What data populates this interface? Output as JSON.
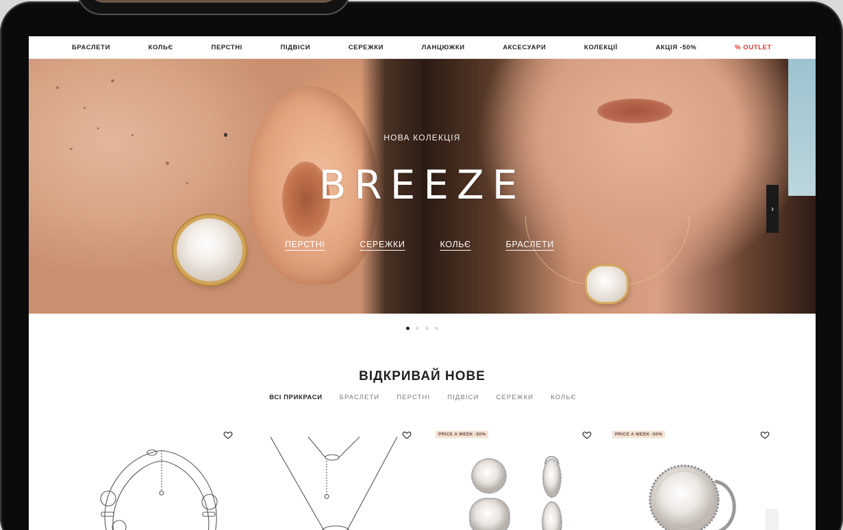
{
  "nav": {
    "items": [
      {
        "label": "БРАСЛЕТИ"
      },
      {
        "label": "КОЛЬЄ"
      },
      {
        "label": "ПЕРСТНІ"
      },
      {
        "label": "ПІДВІСИ"
      },
      {
        "label": "СЕРЕЖКИ"
      },
      {
        "label": "ЛАНЦЮЖКИ"
      },
      {
        "label": "АКСЕСУАРИ"
      },
      {
        "label": "КОЛЕКЦІЇ"
      },
      {
        "label": "АКЦІЯ -50%"
      },
      {
        "label": "% OUTLET"
      }
    ],
    "highlight_color": "#e0342b"
  },
  "hero": {
    "subtitle": "НОВА КОЛЕКЦІЯ",
    "title": "BREEZE",
    "links": [
      "ПЕРСТНІ",
      "СЕРЕЖКИ",
      "КОЛЬЄ",
      "БРАСЛЕТИ"
    ],
    "next_icon": "chevron-right-icon",
    "next_glyph": "›",
    "slides_total": 4,
    "active_slide": 1
  },
  "section": {
    "title": "ВІДКРИВАЙ НОВЕ",
    "filters": [
      "ВСІ ПРИКРАСИ",
      "БРАСЛЕТИ",
      "ПЕРСТНІ",
      "ПІДВІСИ",
      "СЕРЕЖКИ",
      "КОЛЬЄ"
    ],
    "active_filter": "ВСІ ПРИКРАСИ"
  },
  "products": [
    {
      "kind": "bracelet",
      "badge": "",
      "icon": "heart-icon"
    },
    {
      "kind": "necklace",
      "badge": "",
      "icon": "heart-icon"
    },
    {
      "kind": "earrings",
      "badge": "PRICE A WEEK -50%",
      "icon": "heart-icon"
    },
    {
      "kind": "ring",
      "badge": "PRICE A WEEK -50%",
      "icon": "heart-icon"
    }
  ]
}
